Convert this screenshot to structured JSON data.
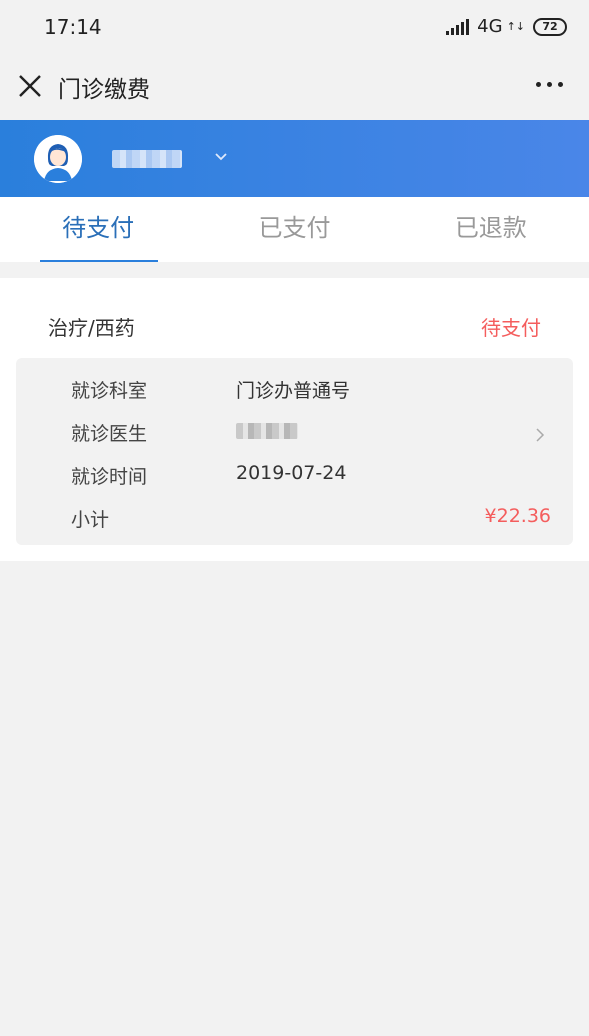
{
  "status_bar": {
    "time": "17:14",
    "network": "4G",
    "battery": "72"
  },
  "nav": {
    "title": "门诊缴费"
  },
  "tabs": [
    {
      "label": "待支付",
      "active": true
    },
    {
      "label": "已支付",
      "active": false
    },
    {
      "label": "已退款",
      "active": false
    }
  ],
  "bill": {
    "category": "治疗/西药",
    "status": "待支付",
    "rows": {
      "department_label": "就诊科室",
      "department_value": "门诊办普通号",
      "doctor_label": "就诊医生",
      "date_label": "就诊时间",
      "date_value": "2019-07-24",
      "subtotal_label": "小计",
      "subtotal_value": "¥22.36"
    }
  },
  "colors": {
    "accent_blue": "#2a7fdc",
    "price_red": "#f45d5d"
  }
}
